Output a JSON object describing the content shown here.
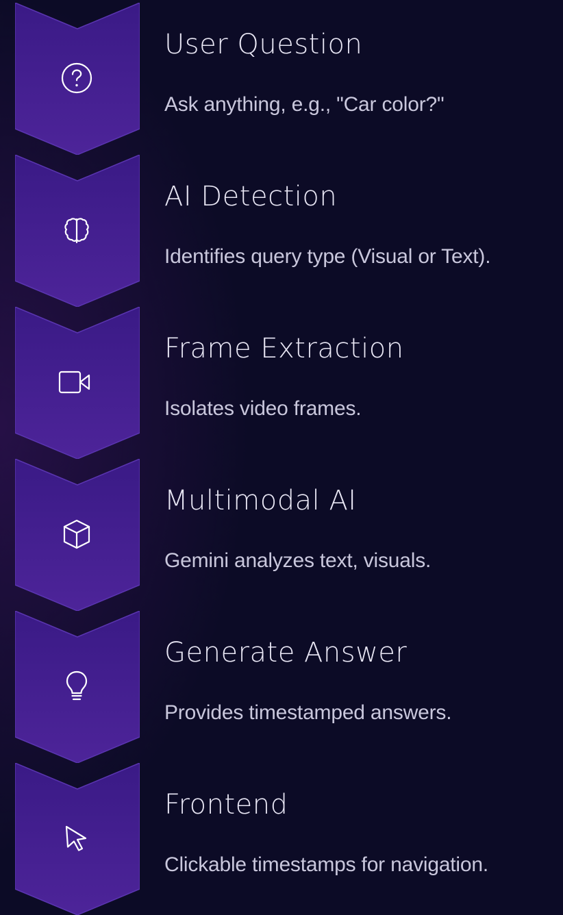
{
  "steps": [
    {
      "title": "User Question",
      "description": "Ask anything, e.g., \"Car color?\"",
      "icon": "question-circle-icon"
    },
    {
      "title": "AI Detection",
      "description": "Identifies query type (Visual or Text).",
      "icon": "brain-icon"
    },
    {
      "title": "Frame Extraction",
      "description": "Isolates video frames.",
      "icon": "video-camera-icon"
    },
    {
      "title": "Multimodal AI",
      "description": "Gemini analyzes text, visuals.",
      "icon": "cube-icon"
    },
    {
      "title": "Generate Answer",
      "description": "Provides timestamped answers.",
      "icon": "lightbulb-icon"
    },
    {
      "title": "Frontend",
      "description": "Clickable timestamps for navigation.",
      "icon": "cursor-arrow-icon"
    }
  ],
  "colors": {
    "background": "#0c0b26",
    "chevron_top": "#3a1a86",
    "chevron_bottom": "#4b2399",
    "chevron_border": "#5a35b0",
    "title_text": "#e8e6f4",
    "description_text": "#c9c7dc",
    "icon_stroke": "#ffffff"
  }
}
